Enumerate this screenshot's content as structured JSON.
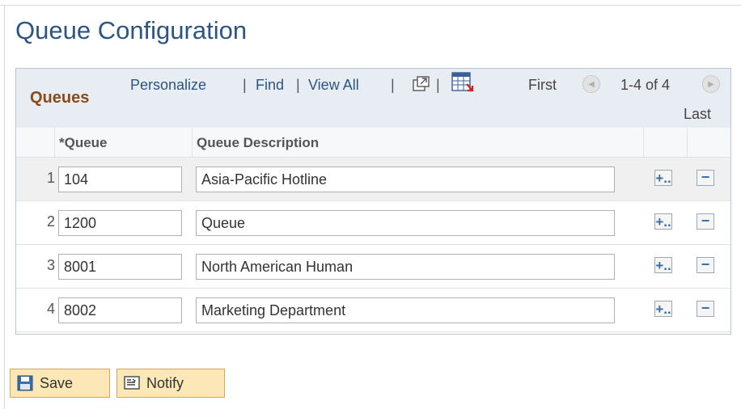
{
  "page": {
    "title": "Queue Configuration"
  },
  "grid": {
    "title": "Queues",
    "toolbar": {
      "personalize": "Personalize",
      "separator": "|",
      "find": "Find",
      "view_all": "View All",
      "new_window_icon": "new-window-icon",
      "download_icon": "download-to-excel-icon"
    },
    "navigation": {
      "first": "First",
      "range": "1-4 of 4",
      "last": "Last",
      "prev_icon": "previous-arrow-icon",
      "next_icon": "next-arrow-icon"
    },
    "columns": {
      "queue": "*Queue",
      "description": "Queue Description"
    },
    "rows": [
      {
        "num": "1",
        "queue": "104",
        "description": "Asia-Pacific Hotline"
      },
      {
        "num": "2",
        "queue": "1200",
        "description": "Queue"
      },
      {
        "num": "3",
        "queue": "8001",
        "description": "North American Human"
      },
      {
        "num": "4",
        "queue": "8002",
        "description": "Marketing Department"
      }
    ],
    "row_actions": {
      "add_icon": "+..",
      "delete_icon": "−"
    }
  },
  "footer": {
    "save_label": "Save",
    "notify_label": "Notify"
  },
  "colors": {
    "title": "#2c5583",
    "grid_title": "#8b4a17",
    "link": "#2c5583",
    "button_bg": "#fbe8b6",
    "button_border": "#d3a85b"
  }
}
